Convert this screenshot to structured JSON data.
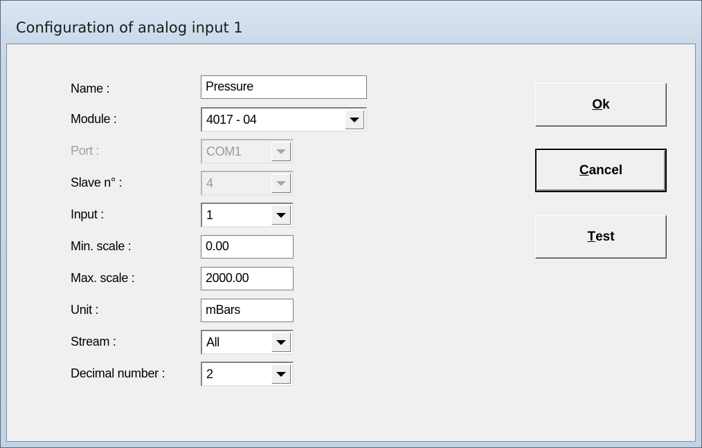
{
  "window": {
    "title": "Configuration of analog input 1"
  },
  "form": {
    "name": {
      "label": "Name :",
      "value": "Pressure"
    },
    "module": {
      "label": "Module :",
      "value": "4017 - 04"
    },
    "port": {
      "label": "Port :",
      "value": "COM1"
    },
    "slave": {
      "label": "Slave n° :",
      "value": "4"
    },
    "input": {
      "label": "Input :",
      "value": "1"
    },
    "min_scale": {
      "label": "Min. scale :",
      "value": "0.00"
    },
    "max_scale": {
      "label": "Max. scale :",
      "value": "2000.00"
    },
    "unit": {
      "label": "Unit :",
      "value": "mBars"
    },
    "stream": {
      "label": "Stream :",
      "value": "All"
    },
    "decimal": {
      "label": "Decimal number :",
      "value": "2"
    }
  },
  "buttons": {
    "ok": {
      "mnemonic": "O",
      "rest": "k"
    },
    "cancel": {
      "mnemonic": "C",
      "rest": "ancel"
    },
    "test": {
      "mnemonic": "T",
      "rest": "est"
    }
  },
  "icons": {
    "dropdown": "chevron-down-icon"
  }
}
